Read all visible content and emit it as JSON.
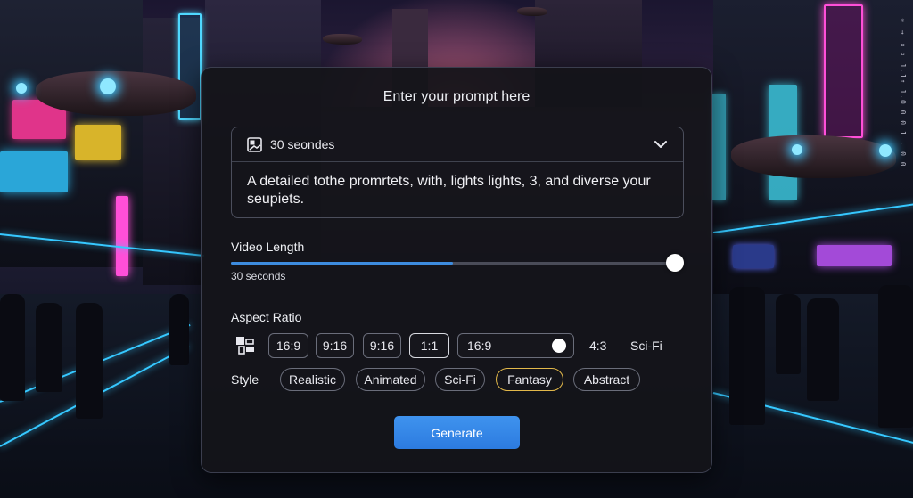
{
  "prompt": {
    "title": "Enter your prompt here",
    "duration_selector": {
      "label": "30 seondes",
      "icon": "image-icon",
      "expand_icon": "chevron-down-icon"
    },
    "text": "A detailed tothe promrtets, with, lights lights, 3,  and diverse your seupiets."
  },
  "video_length": {
    "label": "Video Length",
    "value_text": "30 seconds",
    "fill_fraction": 0.5,
    "accent_color": "#3d8cdf"
  },
  "aspect_ratio": {
    "label": "Aspect Ratio",
    "icon": "layout-icon",
    "options": [
      "16:9",
      "9:16",
      "9:16",
      "1:1",
      "16:9",
      "4:3",
      "Sci-Fi"
    ],
    "selected": "1:1"
  },
  "style": {
    "label": "Style",
    "options": [
      "Realistic",
      "Animated",
      "Sci-Fi",
      "Fantasy",
      "Abstract"
    ],
    "selected": "Fantasy",
    "selected_color": "#e2b84a"
  },
  "generate_label": "Generate",
  "generate_color": "#2c7be0",
  "side_text": "✳ → ▫▫ 1.1↑ 1.0 0 0 1 . 0 0"
}
